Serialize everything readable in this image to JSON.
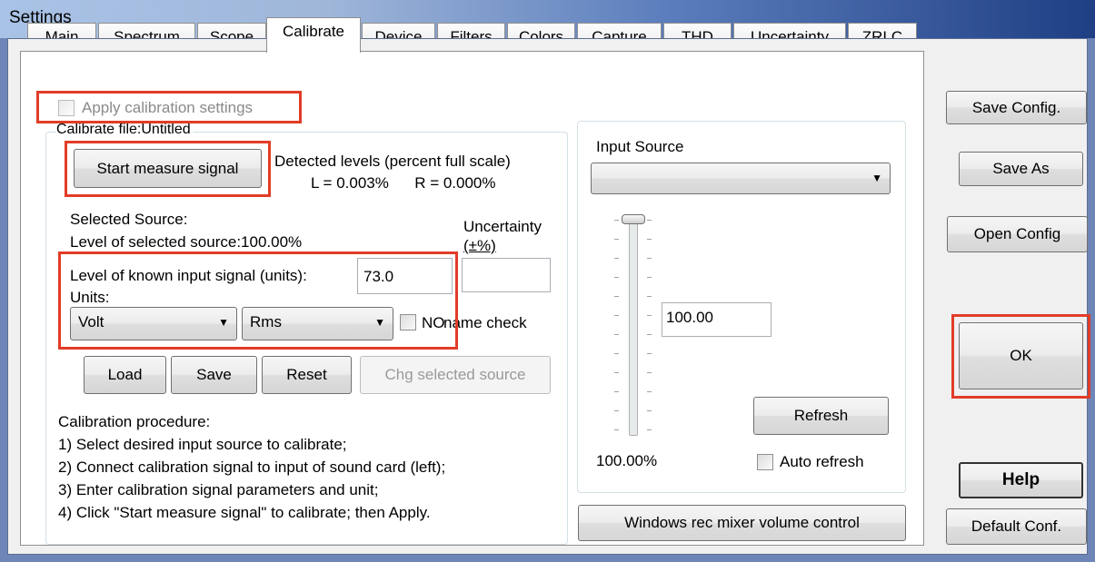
{
  "window": {
    "title": "Settings"
  },
  "tabs": [
    "Main",
    "Spectrum",
    "Scope",
    "Calibrate",
    "Device",
    "Filters",
    "Colors",
    "Capture",
    "THD",
    "Uncertainty",
    "ZRLC"
  ],
  "calibrate": {
    "apply_label": "Apply calibration settings",
    "file_label": "Calibrate file:Untitled",
    "start_button": "Start measure signal",
    "detected_title": "Detected levels (percent full scale)",
    "detected_values": "L = 0.003%      R = 0.000%",
    "selected_source": "Selected Source:",
    "level_selected": "Level of selected source:100.00%",
    "uncertainty_label": "Uncertainty",
    "uncertainty_unit": "(±%)",
    "uncertainty_value": "",
    "known_level_label": "Level of known input signal (units):",
    "known_level_value": "73.0",
    "units_label": "Units:",
    "unit_select": "Volt",
    "type_select": "Rms",
    "no_name_check": "NO",
    "name_check": "name check",
    "load_button": "Load",
    "save_button": "Save",
    "reset_button": "Reset",
    "chg_button": "Chg selected source",
    "procedure_title": "Calibration procedure:",
    "steps": [
      "1) Select desired input source to calibrate;",
      "2) Connect calibration signal to input of sound card (left);",
      "3) Enter calibration signal parameters and unit;",
      "4) Click \"Start measure signal\" to calibrate; then Apply."
    ]
  },
  "input_source": {
    "label": "Input Source",
    "select_value": "",
    "level_value": "100.00",
    "percent_label": "100.00%",
    "slider_level_percent": 100,
    "refresh_button": "Refresh",
    "auto_refresh": "Auto refresh",
    "mixer_button": "Windows rec mixer volume control"
  },
  "side_buttons": {
    "save_config": "Save Config.",
    "save_as": "Save As",
    "open_config": "Open Config",
    "ok": "OK",
    "help": "Help",
    "default_conf": "Default Conf."
  },
  "colors": {
    "highlight": "#e23c28",
    "titlebar_end": "#1f3f84"
  }
}
